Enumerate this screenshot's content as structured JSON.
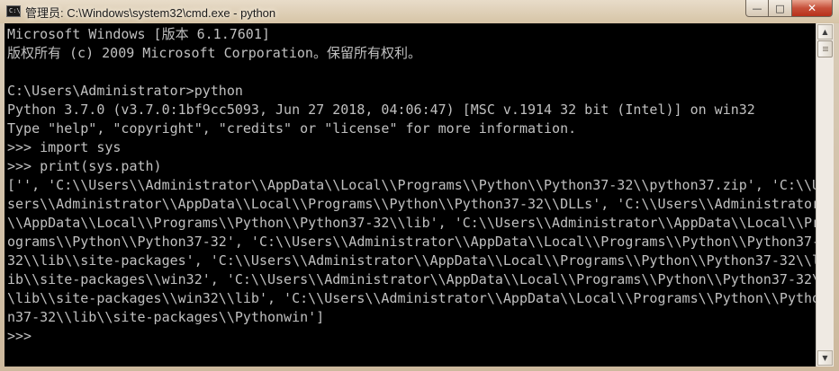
{
  "window": {
    "title": "管理员: C:\\Windows\\system32\\cmd.exe - python",
    "icon_label": "C:\\"
  },
  "controls": {
    "minimize": "—",
    "maximize": "□",
    "close": "✕"
  },
  "console": {
    "lines": [
      "Microsoft Windows [版本 6.1.7601]",
      "版权所有 (c) 2009 Microsoft Corporation。保留所有权利。",
      "",
      "C:\\Users\\Administrator>python",
      "Python 3.7.0 (v3.7.0:1bf9cc5093, Jun 27 2018, 04:06:47) [MSC v.1914 32 bit (Intel)] on win32",
      "Type \"help\", \"copyright\", \"credits\" or \"license\" for more information.",
      ">>> import sys",
      ">>> print(sys.path)",
      "['', 'C:\\\\Users\\\\Administrator\\\\AppData\\\\Local\\\\Programs\\\\Python\\\\Python37-32\\\\python37.zip', 'C:\\\\U",
      "sers\\\\Administrator\\\\AppData\\\\Local\\\\Programs\\\\Python\\\\Python37-32\\\\DLLs', 'C:\\\\Users\\\\Administrator",
      "\\\\AppData\\\\Local\\\\Programs\\\\Python\\\\Python37-32\\\\lib', 'C:\\\\Users\\\\Administrator\\\\AppData\\\\Local\\\\Pr",
      "ograms\\\\Python\\\\Python37-32', 'C:\\\\Users\\\\Administrator\\\\AppData\\\\Local\\\\Programs\\\\Python\\\\Python37-",
      "32\\\\lib\\\\site-packages', 'C:\\\\Users\\\\Administrator\\\\AppData\\\\Local\\\\Programs\\\\Python\\\\Python37-32\\\\l",
      "ib\\\\site-packages\\\\win32', 'C:\\\\Users\\\\Administrator\\\\AppData\\\\Local\\\\Programs\\\\Python\\\\Python37-32\\",
      "\\lib\\\\site-packages\\\\win32\\\\lib', 'C:\\\\Users\\\\Administrator\\\\AppData\\\\Local\\\\Programs\\\\Python\\\\Pytho",
      "n37-32\\\\lib\\\\site-packages\\\\Pythonwin']",
      ">>>"
    ],
    "text_color": "#c0c0c0",
    "background_color": "#000000"
  },
  "scrollbar": {
    "up_arrow": "▲",
    "down_arrow": "▼"
  }
}
